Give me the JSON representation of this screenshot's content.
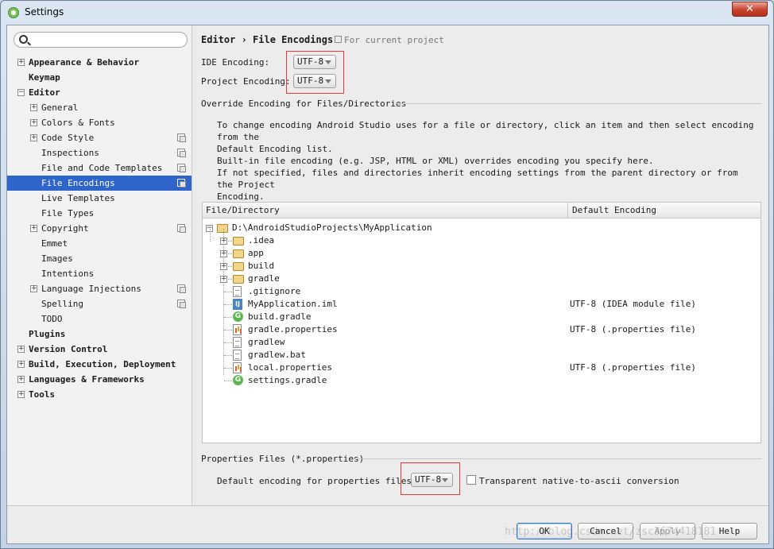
{
  "window": {
    "title": "Settings",
    "close_label": "✕"
  },
  "search": {
    "placeholder": ""
  },
  "tree": [
    {
      "label": "Appearance & Behavior",
      "expander": "+",
      "bold": true
    },
    {
      "label": "Keymap",
      "bold": true
    },
    {
      "label": "Editor",
      "expander": "−",
      "bold": true
    },
    {
      "label": "General",
      "expander": "+"
    },
    {
      "label": "Colors & Fonts",
      "expander": "+"
    },
    {
      "label": "Code Style",
      "expander": "+"
    },
    {
      "label": "Inspections"
    },
    {
      "label": "File and Code Templates"
    },
    {
      "label": "File Encodings",
      "selected": true
    },
    {
      "label": "Live Templates"
    },
    {
      "label": "File Types"
    },
    {
      "label": "Copyright",
      "expander": "+"
    },
    {
      "label": "Emmet"
    },
    {
      "label": "Images"
    },
    {
      "label": "Intentions"
    },
    {
      "label": "Language Injections",
      "expander": "+"
    },
    {
      "label": "Spelling"
    },
    {
      "label": "TODO"
    },
    {
      "label": "Plugins",
      "bold": true
    },
    {
      "label": "Version Control",
      "expander": "+",
      "bold": true
    },
    {
      "label": "Build, Execution, Deployment",
      "expander": "+",
      "bold": true
    },
    {
      "label": "Languages & Frameworks",
      "expander": "+",
      "bold": true
    },
    {
      "label": "Tools",
      "expander": "+",
      "bold": true
    }
  ],
  "header": {
    "breadcrumb": "Editor › File Encodings",
    "scope": "For current project"
  },
  "encodings": {
    "ide_label": "IDE Encoding:",
    "ide_value": "UTF-8",
    "project_label": "Project Encoding:",
    "project_value": "UTF-8"
  },
  "override": {
    "title": "Override Encoding for Files/Directories",
    "para1_line1": "To change encoding Android Studio uses for a file or directory, click an item and then select encoding from the",
    "para1_line2": "Default Encoding list.",
    "para2_line1": "Built-in file encoding (e.g. JSP, HTML or XML) overrides encoding you specify here.",
    "para2_line2": "If not specified, files and directories inherit encoding settings from the parent directory or from the Project",
    "para2_line3": "Encoding."
  },
  "table": {
    "col_file": "File/Directory",
    "col_encoding": "Default Encoding",
    "root": "D:\\AndroidStudioProjects\\MyApplication",
    "rows": [
      {
        "name": ".idea",
        "kind": "folder",
        "encoding": ""
      },
      {
        "name": "app",
        "kind": "folder",
        "encoding": ""
      },
      {
        "name": "build",
        "kind": "folder",
        "encoding": ""
      },
      {
        "name": "gradle",
        "kind": "folder",
        "encoding": ""
      },
      {
        "name": ".gitignore",
        "kind": "file",
        "encoding": ""
      },
      {
        "name": "MyApplication.iml",
        "kind": "iml",
        "encoding": "UTF-8 (IDEA module file)"
      },
      {
        "name": "build.gradle",
        "kind": "gradle",
        "encoding": ""
      },
      {
        "name": "gradle.properties",
        "kind": "props",
        "encoding": "UTF-8 (.properties file)"
      },
      {
        "name": "gradlew",
        "kind": "file",
        "encoding": ""
      },
      {
        "name": "gradlew.bat",
        "kind": "file",
        "encoding": ""
      },
      {
        "name": "local.properties",
        "kind": "props",
        "encoding": "UTF-8 (.properties file)"
      },
      {
        "name": "settings.gradle",
        "kind": "gradle",
        "encoding": ""
      }
    ]
  },
  "properties": {
    "title": "Properties Files (*.properties)",
    "default_label": "Default encoding for properties files:",
    "default_value": "UTF-8",
    "transparent_label": "Transparent native-to-ascii conversion",
    "transparent_checked": false
  },
  "buttons": {
    "ok": "OK",
    "cancel": "Cancel",
    "apply": "Apply",
    "help": "Help"
  },
  "watermark": "http://blog.csdn.net/zsc3674418181",
  "colors": {
    "selection": "#2f65ca",
    "highlight_box": "#e03a3a"
  }
}
